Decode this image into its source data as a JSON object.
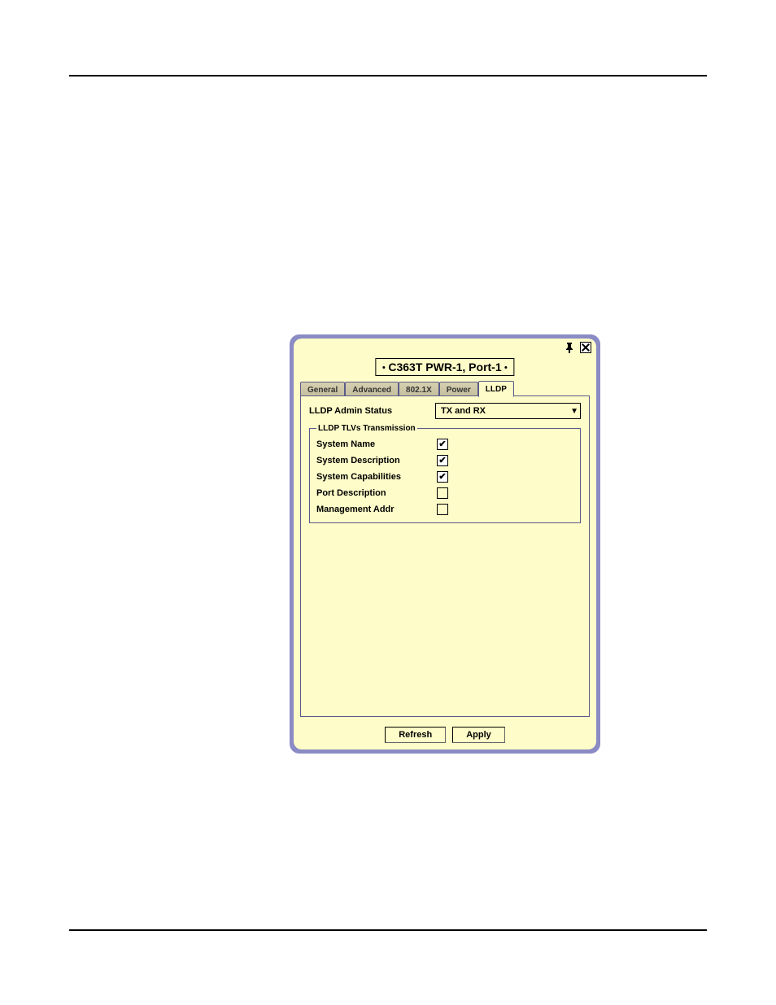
{
  "title": "C363T PWR-1, Port-1",
  "tabs": [
    {
      "label": "General",
      "active": false
    },
    {
      "label": "Advanced",
      "active": false
    },
    {
      "label": "802.1X",
      "active": false
    },
    {
      "label": "Power",
      "active": false
    },
    {
      "label": "LLDP",
      "active": true
    }
  ],
  "form": {
    "lldp_admin_status_label": "LLDP Admin Status",
    "lldp_admin_status_value": "TX and RX"
  },
  "tlv_group": {
    "legend": "LLDP TLVs Transmission",
    "rows": [
      {
        "label": "System Name",
        "checked": true
      },
      {
        "label": "System Description",
        "checked": true
      },
      {
        "label": "System Capabilities",
        "checked": true
      },
      {
        "label": "Port Description",
        "checked": false
      },
      {
        "label": "Management Addr",
        "checked": false
      }
    ]
  },
  "buttons": {
    "refresh": "Refresh",
    "apply": "Apply"
  }
}
